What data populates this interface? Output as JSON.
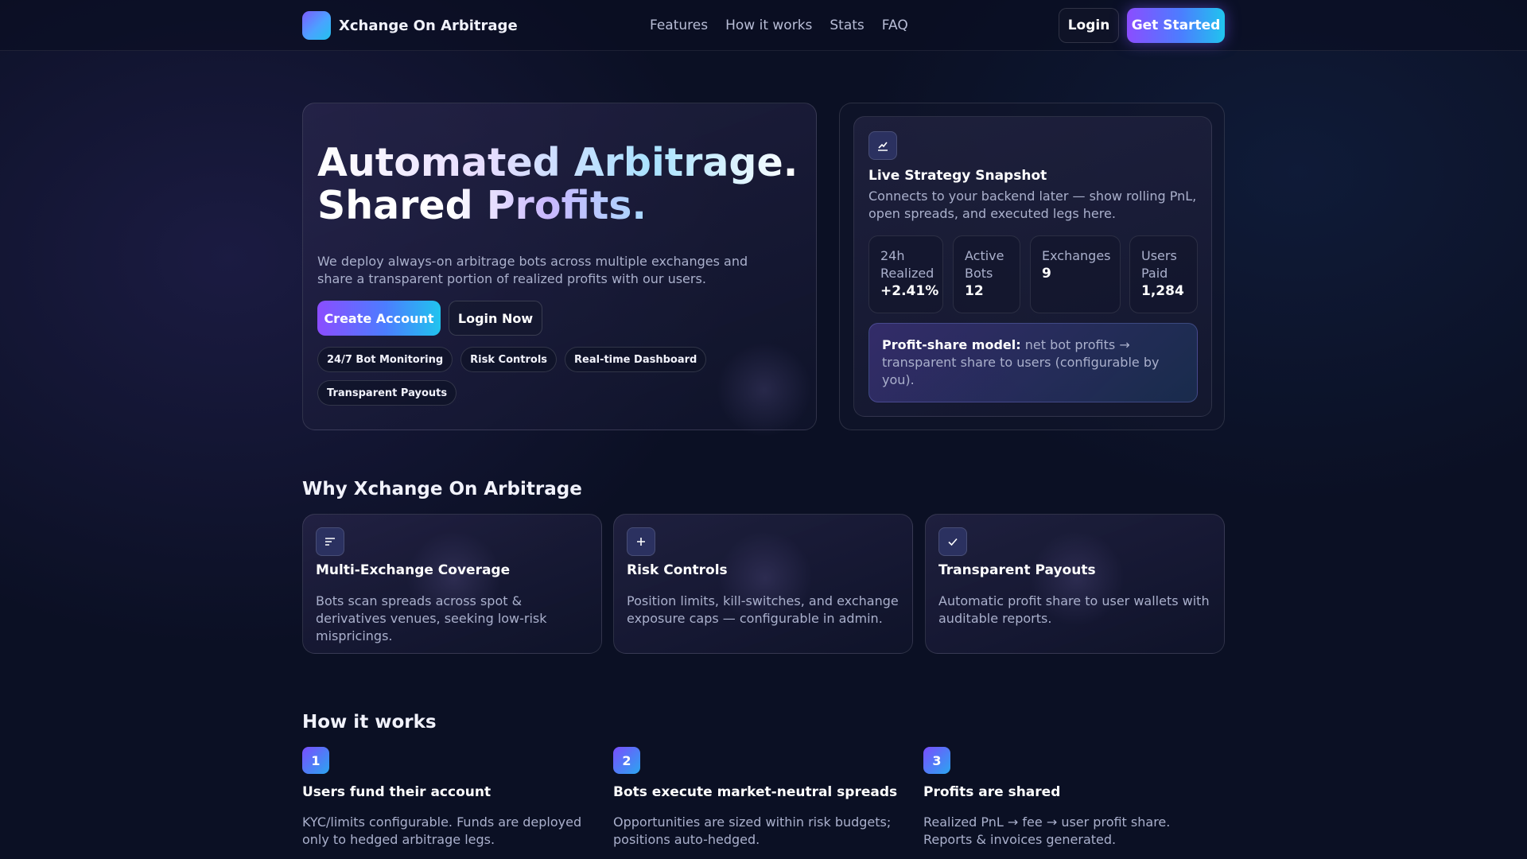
{
  "header": {
    "brand_name": "Xchange On Arbitrage",
    "nav": [
      "Features",
      "How it works",
      "Stats",
      "FAQ"
    ],
    "login_label": "Login",
    "get_started_label": "Get Started"
  },
  "hero": {
    "title_line1": "Automated Arbitrage.",
    "title_line2": "Shared Profits.",
    "subtitle": "We deploy always-on arbitrage bots across multiple exchanges and share a transparent portion of realized profits with our users.",
    "create_account_label": "Create Account",
    "login_now_label": "Login Now",
    "chips": [
      "24/7 Bot Monitoring",
      "Risk Controls",
      "Real-time Dashboard",
      "Transparent Payouts"
    ]
  },
  "snapshot": {
    "icon": "chart-line-icon",
    "title": "Live Strategy Snapshot",
    "description": "Connects to your backend later — show rolling PnL, open spreads, and executed legs here.",
    "stats": [
      {
        "label_1": "24h",
        "label_2": "Realized",
        "value": "+2.41%"
      },
      {
        "label_1": "Active",
        "label_2": "Bots",
        "value": "12"
      },
      {
        "label_1": "Exchanges",
        "label_2": "",
        "value": "9"
      },
      {
        "label_1": "Users",
        "label_2": "Paid",
        "value": "1,284"
      }
    ],
    "profit_model_label": "Profit-share model:",
    "profit_model_text": "net bot profits → transparent share to users (configurable by you)."
  },
  "why": {
    "title": "Why Xchange On Arbitrage",
    "features": [
      {
        "icon": "list-lines-icon",
        "title": "Multi-Exchange Coverage",
        "desc": "Bots scan spreads across spot & derivatives venues, seeking low-risk mispricings."
      },
      {
        "icon": "plus-icon",
        "title": "Risk Controls",
        "desc": "Position limits, kill-switches, and exchange exposure caps — configurable in admin."
      },
      {
        "icon": "check-icon",
        "title": "Transparent Payouts",
        "desc": "Automatic profit share to user wallets with auditable reports."
      }
    ]
  },
  "how": {
    "title": "How it works",
    "steps": [
      {
        "num": "1",
        "title": "Users fund their account",
        "desc": "KYC/limits configurable. Funds are deployed only to hedged arbitrage legs."
      },
      {
        "num": "2",
        "title": "Bots execute market-neutral spreads",
        "desc": "Opportunities are sized within risk budgets; positions auto-hedged."
      },
      {
        "num": "3",
        "title": "Profits are shared",
        "desc": "Realized PnL → fee → user profit share. Reports & invoices generated."
      }
    ]
  },
  "colors": {
    "background": "#0b1024",
    "accent_purple": "#8b4dff",
    "accent_cyan": "#20c4ee"
  }
}
